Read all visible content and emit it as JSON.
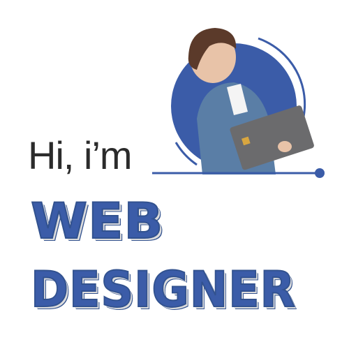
{
  "greeting": "Hi, i’m",
  "title_line1": "WEB",
  "title_line2": "DESIGNER",
  "colors": {
    "accent": "#3b5ca8",
    "text": "#2b2b2b",
    "shadow": "#dcdcdc"
  },
  "image": {
    "subject": "person-holding-laptop"
  }
}
